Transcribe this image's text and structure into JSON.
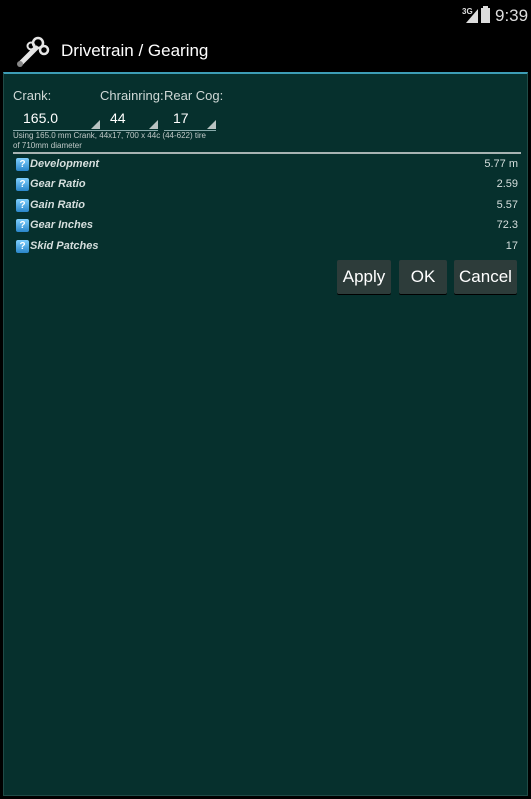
{
  "status": {
    "network": "3G",
    "time": "9:39"
  },
  "header": {
    "title": "Drivetrain / Gearing",
    "icon": "wrench-gear-icon"
  },
  "form": {
    "crank_label": "Crank:",
    "chainring_label": "Chrainring:",
    "rear_cog_label": "Rear Cog:",
    "crank_value": "165.0",
    "chainring_value": "44",
    "rear_cog_value": "17",
    "note_line1": "Using 165.0 mm Crank, 44x17, 700 x 44c (44-622) tire",
    "note_line2": "of 710mm diameter"
  },
  "results": [
    {
      "name": "Development",
      "value": "5.77 m"
    },
    {
      "name": "Gear Ratio",
      "value": "2.59"
    },
    {
      "name": "Gain Ratio",
      "value": "5.57"
    },
    {
      "name": "Gear Inches",
      "value": "72.3"
    },
    {
      "name": "Skid Patches",
      "value": "17"
    }
  ],
  "buttons": {
    "apply": "Apply",
    "ok": "OK",
    "cancel": "Cancel"
  },
  "colors": {
    "dialog_bg": "#06302d",
    "accent": "#3d9db6",
    "help_icon": "#2a86c9"
  }
}
